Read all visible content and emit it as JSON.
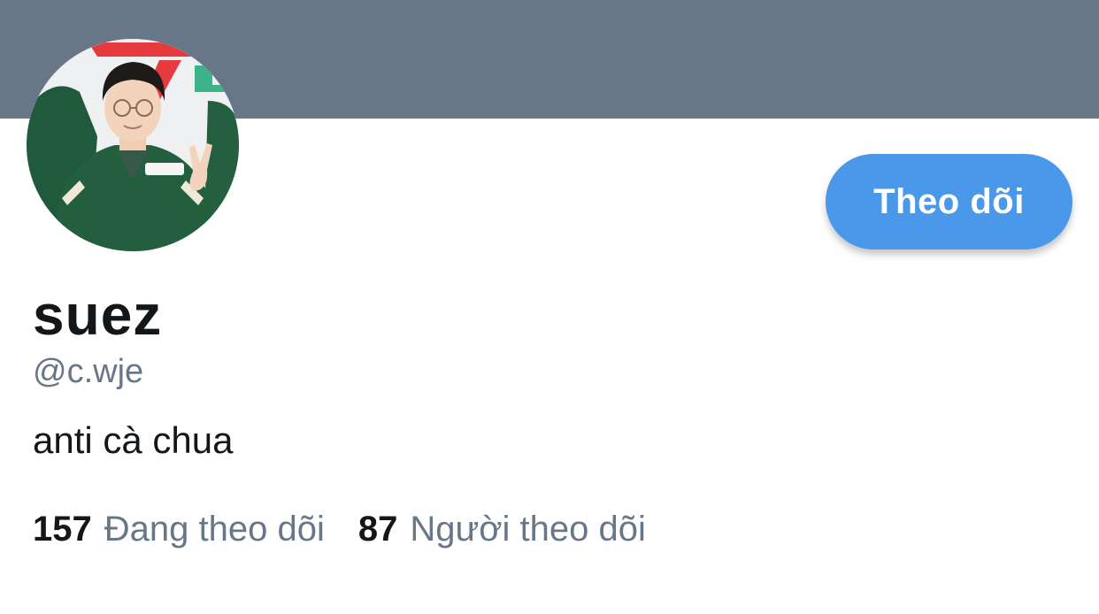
{
  "profile": {
    "display_name": "suez",
    "handle": "@c.wje",
    "bio": "anti cà chua",
    "follow_button_label": "Theo dõi",
    "banner_color": "#687788",
    "accent_color": "#4a98ea"
  },
  "stats": {
    "following": {
      "count": "157",
      "label": "Đang theo dõi"
    },
    "followers": {
      "count": "87",
      "label": "Người theo dõi"
    }
  }
}
